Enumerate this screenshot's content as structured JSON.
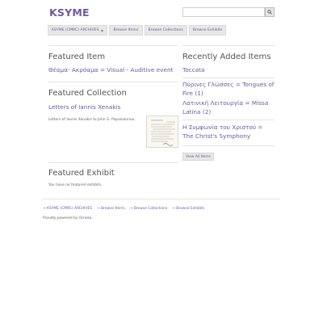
{
  "site": {
    "title": "KSYME"
  },
  "search": {
    "placeholder": ""
  },
  "nav": {
    "items": [
      {
        "label": "KSYME (CMRC) ARCHIVES"
      },
      {
        "label": "Browse Items"
      },
      {
        "label": "Browse Collections"
      },
      {
        "label": "Browse Exhibits"
      }
    ]
  },
  "featured_item": {
    "heading": "Featured Item",
    "title": "Θέαμα- Ακρόαμα = Visual - Auditive event"
  },
  "featured_collection": {
    "heading": "Featured Collection",
    "title": "Letters of Iannis Xenakis",
    "description": "Letters of Iannis Xenakis to John G. Papaioannou."
  },
  "recent": {
    "heading": "Recently Added Items",
    "items": [
      {
        "title": "Toccata"
      },
      {
        "title": "Πύρινες Γλώσσες = Tongues of Fire (1)"
      },
      {
        "title": "Λατινική Λειτουργία = Missa Latina (2)"
      },
      {
        "title": "Η Συμφωνία του Χριστού = The Christ's Symphony"
      }
    ],
    "view_all": "View All Items"
  },
  "featured_exhibit": {
    "heading": "Featured Exhibit",
    "empty": "You have no featured exhibits."
  },
  "footer": {
    "links": [
      {
        "label": "→ KSYME (CMRC) ARCHIVES"
      },
      {
        "label": "→ Browse Items"
      },
      {
        "label": "→ Browse Collections"
      },
      {
        "label": "→ Browse Exhibits"
      }
    ],
    "powered_prefix": "Proudly powered by ",
    "powered_link": "Omeka",
    "powered_suffix": "."
  },
  "colors": {
    "accent": "#6a5aa8",
    "title": "#6f5a9e",
    "nav_bg": "#e8e8e8"
  }
}
